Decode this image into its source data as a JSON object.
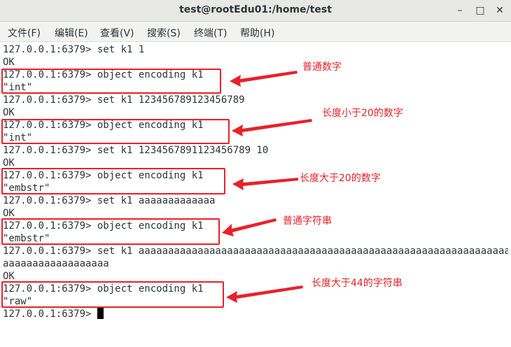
{
  "window": {
    "title": "test@rootEdu01:/home/test",
    "minimize_glyph": "–",
    "maximize_glyph": "□",
    "close_glyph": "✕"
  },
  "menu": [
    "文件(F)",
    "编辑(E)",
    "查看(V)",
    "搜索(S)",
    "终端(T)",
    "帮助(H)"
  ],
  "terminal": {
    "lines": [
      "127.0.0.1:6379> set k1 1",
      "OK",
      "127.0.0.1:6379> object encoding k1",
      "\"int\"",
      "127.0.0.1:6379> set k1 123456789123456789",
      "OK",
      "127.0.0.1:6379> object encoding k1",
      "\"int\"",
      "127.0.0.1:6379> set k1 1234567891123456789 10",
      "OK",
      "127.0.0.1:6379> object encoding k1",
      "\"embstr\"",
      "127.0.0.1:6379> set k1 aaaaaaaaaaaaa",
      "OK",
      "127.0.0.1:6379> object encoding k1",
      "\"embstr\"",
      "127.0.0.1:6379> set k1 aaaaaaaaaaaaaaaaaaaaaaaaaaaaaaaaaaaaaaaaaaaaaaaaaaaaaaaaaaaaaaa",
      "aaaaaaaaaaaaaaaaaa",
      "OK",
      "127.0.0.1:6379> object encoding k1",
      "\"raw\"",
      "127.0.0.1:6379> "
    ]
  },
  "annotations": [
    "普通数字",
    "长度小于20的数字",
    "长度大于20的数字",
    "普通字符串",
    "长度大于44的字符串"
  ],
  "colors": {
    "annotation": "#e8212a",
    "terminal_text": "#2e3436",
    "terminal_bg": "#ffffff"
  }
}
